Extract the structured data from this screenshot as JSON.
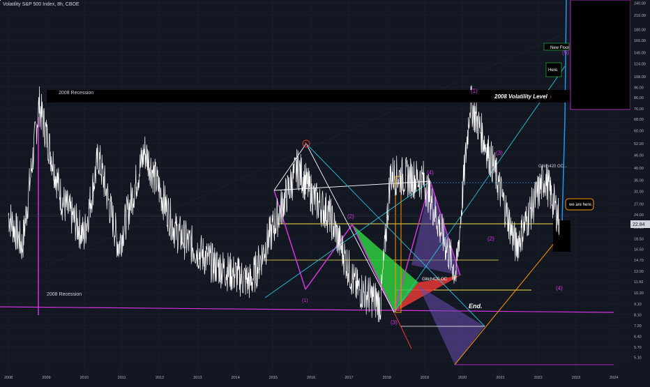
{
  "header": {
    "symbol_line": "Volatility S&P 500 Index, 8h, CBOE"
  },
  "chart_data": {
    "type": "line",
    "series": [
      {
        "name": "",
        "color": "#ffffff"
      }
    ],
    "x_ticks": [
      "2008",
      "2009",
      "2010",
      "2011",
      "2012",
      "2013",
      "2014",
      "2015",
      "2016",
      "2017",
      "2018",
      "2019",
      "2020",
      "2021",
      "2022",
      "2023",
      "2024"
    ],
    "y_ticks": [
      5.1,
      5.7,
      6.4,
      7.2,
      8.1,
      9.1,
      10.3,
      11.6,
      13.0,
      14.7,
      16.5,
      18.5,
      21.0,
      24.0,
      27.0,
      31.0,
      35.0,
      40.0,
      46.0,
      52.0,
      60.0,
      68.0,
      76.0,
      86.0,
      96.0,
      108.0,
      124.0,
      140.0,
      160.0,
      180.0,
      210.0,
      240.0
    ],
    "y_scale": "log",
    "y_range": [
      5.1,
      240.0
    ],
    "x_range": [
      "2008-01-01",
      "2024-01-01"
    ],
    "last_price": "22.84",
    "key_points": [
      {
        "date": "2008-10-24",
        "value": 80
      },
      {
        "date": "2010-05-20",
        "value": 45
      },
      {
        "date": "2011-08-08",
        "value": 48
      },
      {
        "date": "2015-08-24",
        "value": 40
      },
      {
        "date": "2017-11-03",
        "value": 9.1
      },
      {
        "date": "2018-02-05",
        "value": 37
      },
      {
        "date": "2020-03-16",
        "value": 82
      },
      {
        "date": "2022-03-07",
        "value": 36
      },
      {
        "date": "2022-07-25",
        "value": 22.84
      }
    ],
    "grid": true,
    "legend": "none"
  },
  "annotations": {
    "recession_top": "2008 Recession",
    "recession_bottom": "2008 Recession",
    "vol_level": "2008 Volatility Level",
    "vol_level_arrow": "›",
    "new_floor": "New Floor",
    "here": "Here.",
    "we_are_here": "we are here.",
    "end": "End.",
    "glitch1": "Glitch420 OC...",
    "glitch2": "Glitch420 OC",
    "wave1": "(1)",
    "wave2": "(2)",
    "wave3": "(3)",
    "wave4": "(4)",
    "wave5": "(5)",
    "label_A": "A"
  },
  "colors": {
    "background": "#131722",
    "grid": "#1e2230",
    "price": "#ffffff",
    "magenta": "#d633e0",
    "cyan": "#26c6da",
    "yellow": "#f5e44a",
    "orange": "#ff9800",
    "red": "#e53935",
    "green": "#2ecc40",
    "purple": "#6a4fb0",
    "blue": "#2196f3"
  }
}
